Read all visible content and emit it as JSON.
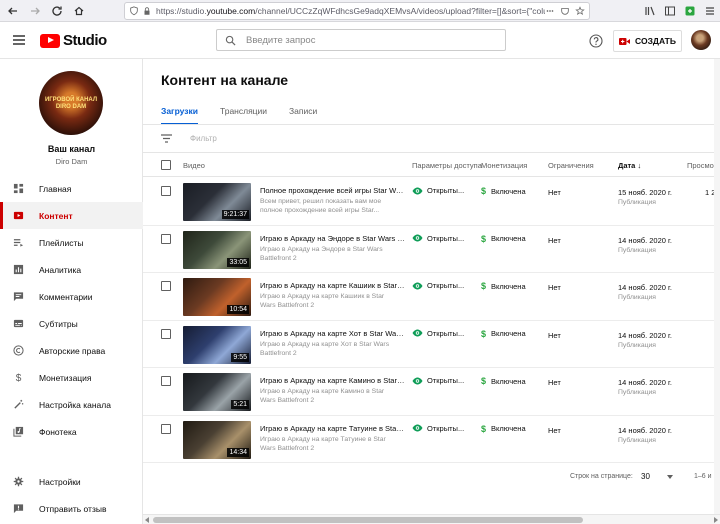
{
  "browser": {
    "url_prefix": "https://studio.",
    "url_domain": "youtube.com",
    "url_rest": "/channel/UCCzZqWFdhcsGe9adqXEMvsA/videos/upload?filter=[]&sort={\"column\"..."
  },
  "header": {
    "logo_text": "Studio",
    "search_placeholder": "Введите запрос",
    "create_label": "СОЗДАТЬ"
  },
  "sidebar": {
    "avatar_text": "ИГРОВОЙ КАНАЛ DIRO DAM",
    "channel_label": "Ваш канал",
    "channel_name": "Diro Dam",
    "items": [
      {
        "label": "Главная",
        "icon": "dashboard-icon"
      },
      {
        "label": "Контент",
        "icon": "content-icon",
        "active": true
      },
      {
        "label": "Плейлисты",
        "icon": "playlist-icon"
      },
      {
        "label": "Аналитика",
        "icon": "analytics-icon"
      },
      {
        "label": "Комментарии",
        "icon": "comments-icon"
      },
      {
        "label": "Субтитры",
        "icon": "subtitles-icon"
      },
      {
        "label": "Авторские права",
        "icon": "copyright-icon"
      },
      {
        "label": "Монетизация",
        "icon": "dollar-icon"
      },
      {
        "label": "Настройка канала",
        "icon": "wand-icon"
      },
      {
        "label": "Фонотека",
        "icon": "music-library-icon"
      }
    ],
    "bottom_items": [
      {
        "label": "Настройки",
        "icon": "gear-icon"
      },
      {
        "label": "Отправить отзыв",
        "icon": "feedback-icon"
      }
    ]
  },
  "main": {
    "title": "Контент на канале",
    "tabs": [
      {
        "label": "Загрузки",
        "active": true
      },
      {
        "label": "Трансляции"
      },
      {
        "label": "Записи"
      }
    ],
    "filter_placeholder": "Фильтр",
    "columns": {
      "video": "Видео",
      "visibility": "Параметры доступа",
      "monetization": "Монетизация",
      "restrictions": "Ограничения",
      "date": "Дата",
      "views": "Просмо"
    },
    "rows": [
      {
        "title": "Полное прохождение всей игры Star Wars Battlefront 2",
        "desc": "Всем привет, решил показать вам мое полное прохождение всей игры Star...",
        "duration": "9:21:37",
        "visibility": "Открыты...",
        "monetization": "Включена",
        "restrictions": "Нет",
        "date": "15 нояб. 2020 г.",
        "date_sub": "Публикация",
        "views": "1 2",
        "thumb_colors": [
          "#2b2f38",
          "#7f8a96",
          "#1a1d24"
        ]
      },
      {
        "title": "Играю в Аркаду на Эндоре в Star Wars Battlefront 2",
        "desc": "Играю в Аркаду на Эндоре в Star Wars Battlefront 2",
        "duration": "33:05",
        "visibility": "Открыты...",
        "monetization": "Включена",
        "restrictions": "Нет",
        "date": "14 нояб. 2020 г.",
        "date_sub": "Публикация",
        "views": "",
        "thumb_colors": [
          "#3e4a3a",
          "#8a9478",
          "#1f2419"
        ]
      },
      {
        "title": "Играю в Аркаду на карте Кашиик в Star Wars Battlefront 2",
        "desc": "Играю в Аркаду на карте Кашиик в Star Wars Battlefront 2",
        "duration": "10:54",
        "visibility": "Открыты...",
        "monetization": "Включена",
        "restrictions": "Нет",
        "date": "14 нояб. 2020 г.",
        "date_sub": "Публикация",
        "views": "",
        "thumb_colors": [
          "#6b3a22",
          "#c0612c",
          "#2e1a10"
        ]
      },
      {
        "title": "Играю в Аркаду на карте Хот в Star Wars Battlefront 2",
        "desc": "Играю в Аркаду на карте Хот в Star Wars Battlefront 2",
        "duration": "9:55",
        "visibility": "Открыты...",
        "monetization": "Включена",
        "restrictions": "Нет",
        "date": "14 нояб. 2020 г.",
        "date_sub": "Публикация",
        "views": "",
        "thumb_colors": [
          "#2e3f6e",
          "#8fa8d6",
          "#151c33"
        ]
      },
      {
        "title": "Играю в Аркаду на карте Камино в Star Wars Battlefront 2",
        "desc": "Играю в Аркаду на карте Камино в Star Wars Battlefront 2",
        "duration": "5:21",
        "visibility": "Открыты...",
        "monetization": "Включена",
        "restrictions": "Нет",
        "date": "14 нояб. 2020 г.",
        "date_sub": "Публикация",
        "views": "",
        "thumb_colors": [
          "#33383d",
          "#9aa3a8",
          "#16191c"
        ]
      },
      {
        "title": "Играю в Аркаду на карте Татуине в Star Wars Battlefront 2",
        "desc": "Играю в Аркаду на карте Татуине в Star Wars Battlefront 2",
        "duration": "14:34",
        "visibility": "Открыты...",
        "monetization": "Включена",
        "restrictions": "Нет",
        "date": "14 нояб. 2020 г.",
        "date_sub": "Публикация",
        "views": "",
        "thumb_colors": [
          "#4a4033",
          "#a8906a",
          "#201a12"
        ]
      }
    ],
    "pagination": {
      "rows_label": "Строк на странице:",
      "rows_value": "30",
      "range": "1–6 и"
    }
  },
  "colors": {
    "accent": "#065fd4",
    "active_nav": "#cc0000",
    "monetization_green": "#2ba640",
    "visibility_green": "#0f9d58"
  }
}
